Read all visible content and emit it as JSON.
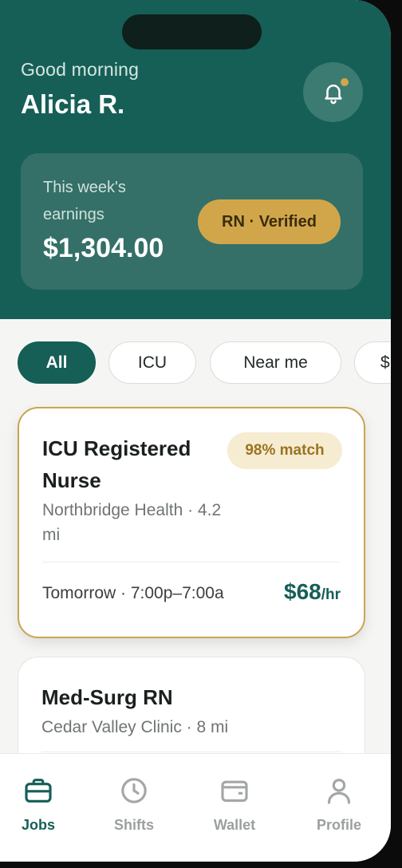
{
  "header": {
    "greeting": "Good morning",
    "user_name": "Alicia R.",
    "notification_icon": "bell-icon",
    "has_unread": true
  },
  "earnings": {
    "label": "This week's earnings",
    "amount": "$1,304.00",
    "badge": "RN · Verified"
  },
  "filters": {
    "chips": [
      "All",
      "ICU",
      "Near me",
      "$"
    ],
    "selected": "All"
  },
  "jobs": [
    {
      "title": "ICU Registered Nurse",
      "match": "98% match",
      "facility_distance": "Northbridge Health · 4.2 mi",
      "shift": "Tomorrow · 7:00p–7:00a",
      "pay_amount": "$68",
      "pay_unit": "/hr"
    },
    {
      "title": "Med-Surg RN",
      "facility_distance": "Cedar Valley Clinic · 8 mi"
    }
  ],
  "tabs": [
    {
      "label": "Jobs",
      "icon": "briefcase-icon",
      "active": true
    },
    {
      "label": "Shifts",
      "icon": "clock-icon",
      "active": false
    },
    {
      "label": "Wallet",
      "icon": "wallet-icon",
      "active": false
    },
    {
      "label": "Profile",
      "icon": "person-icon",
      "active": false
    }
  ],
  "colors": {
    "brand": "#155f57",
    "accent_gold": "#d1a64a",
    "background": "#f5f6f3"
  }
}
